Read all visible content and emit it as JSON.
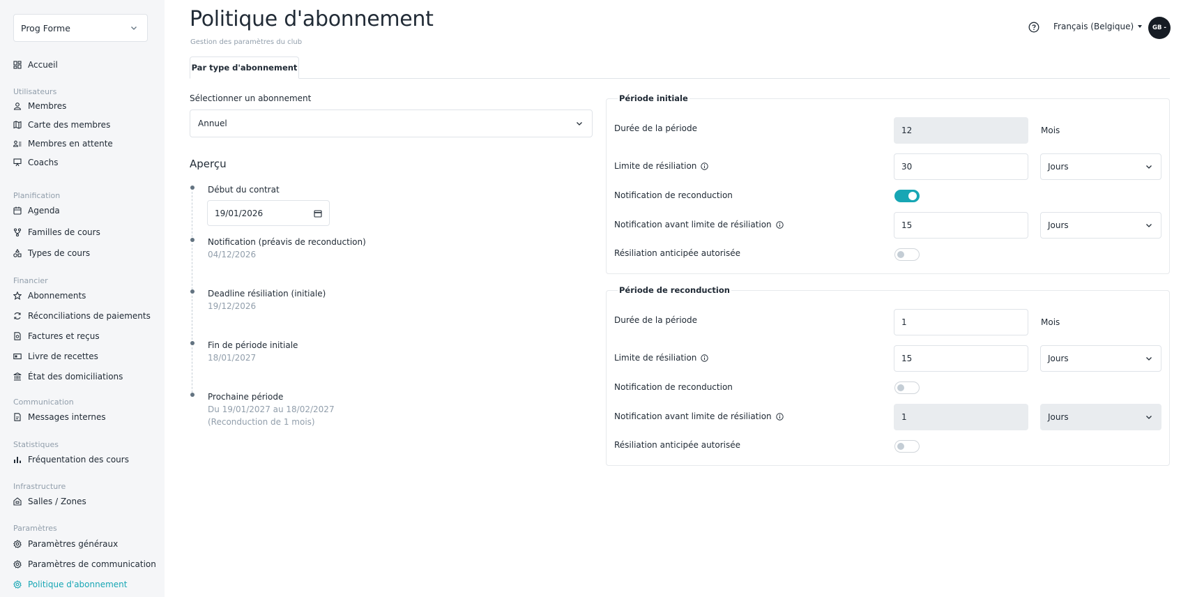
{
  "sidebar": {
    "club_select": "Prog Forme",
    "home": "Accueil",
    "sections": {
      "users": "Utilisateurs",
      "planning": "Planification",
      "finance": "Financier",
      "communication": "Communication",
      "stats": "Statistiques",
      "infrastructure": "Infrastructure",
      "settings": "Paramètres"
    },
    "items": {
      "members": "Membres",
      "members_map": "Carte des membres",
      "pending_members": "Membres en attente",
      "coaches": "Coachs",
      "agenda": "Agenda",
      "course_families": "Familles de cours",
      "course_types": "Types de cours",
      "subscriptions": "Abonnements",
      "payment_reconciliations": "Réconciliations de paiements",
      "invoices": "Factures et reçus",
      "cashbook": "Livre de recettes",
      "direct_debits": "État des domiciliations",
      "internal_messages": "Messages internes",
      "attendance": "Fréquentation des cours",
      "rooms": "Salles / Zones",
      "general_settings": "Paramètres généraux",
      "communication_settings": "Paramètres de communication",
      "subscription_policy": "Politique d'abonnement"
    },
    "active_color": "#17a6b4"
  },
  "header": {
    "title": "Politique d'abonnement",
    "subtitle": "Gestion des paramètres du club",
    "language": "Français (Belgique)",
    "avatar_initials": "GB -"
  },
  "tabs": [
    "Par type d'abonnement"
  ],
  "left": {
    "select_label": "Sélectionner un abonnement",
    "select_value": "Annuel",
    "preview_title": "Aperçu",
    "timeline": {
      "contract_start_title": "Début du contrat",
      "contract_start_value": "19/01/2026",
      "notification_title": "Notification (préavis de reconduction)",
      "notification_date": "04/12/2026",
      "deadline_title": "Deadline résiliation (initiale)",
      "deadline_date": "19/12/2026",
      "end_title": "Fin de période initiale",
      "end_date": "18/01/2027",
      "next_title": "Prochaine période",
      "next_range": "Du 19/01/2027 au 18/02/2027",
      "next_note": "(Reconduction de 1 mois)"
    }
  },
  "initial": {
    "title": "Période initiale",
    "duration_label": "Durée de la période",
    "duration_value": "12",
    "duration_unit": "Mois",
    "limit_label": "Limite de résiliation",
    "limit_value": "30",
    "limit_unit": "Jours",
    "renewal_notif_label": "Notification de reconduction",
    "renewal_notif_on": true,
    "notif_before_label": "Notification avant limite de résiliation",
    "notif_before_value": "15",
    "notif_before_unit": "Jours",
    "early_label": "Résiliation anticipée autorisée",
    "early_on": false
  },
  "renewal": {
    "title": "Période de reconduction",
    "duration_label": "Durée de la période",
    "duration_value": "1",
    "duration_unit": "Mois",
    "limit_label": "Limite de résiliation",
    "limit_value": "15",
    "limit_unit": "Jours",
    "renewal_notif_label": "Notification de reconduction",
    "renewal_notif_on": false,
    "notif_before_label": "Notification avant limite de résiliation",
    "notif_before_value": "1",
    "notif_before_unit": "Jours",
    "early_label": "Résiliation anticipée autorisée",
    "early_on": false
  },
  "colors": {
    "accent": "#17a6b4",
    "text": "#212b36",
    "muted": "#919eab"
  }
}
